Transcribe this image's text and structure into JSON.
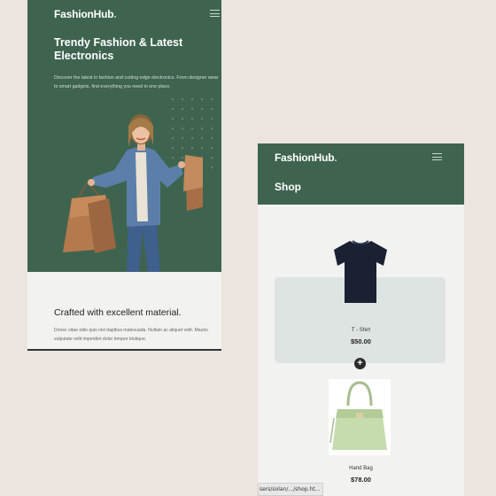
{
  "left": {
    "brand": "FashionHub",
    "brand_dot": ".",
    "hero_title": "Trendy Fashion & Latest Electronics",
    "hero_desc": "Discover the latest in fashion and cutting-edge electronics. From designer wear to smart gadgets, find everything you need in one place.",
    "section_title": "Crafted with excellent material.",
    "section_text": "Donec vitae odio quis nisl dapibus malesuada. Nullam ac aliquet velit. Mauris vulputate velit imperdiet dolor tempor tristique.",
    "icons": [
      "menu-icon"
    ]
  },
  "right": {
    "brand": "FashionHub",
    "brand_dot": ".",
    "page_title": "Shop",
    "products": [
      {
        "name": "T - Shirt",
        "price": "$50.00"
      },
      {
        "name": "Hand Bag",
        "price": "$78.00"
      }
    ],
    "icons": [
      "menu-icon",
      "plus-icon"
    ]
  },
  "status_url": "sers/solan/.../shop.ht...",
  "colors": {
    "brand_green": "#3e6450",
    "page_bg": "#ece4df",
    "card_bg": "#dde4e1"
  }
}
